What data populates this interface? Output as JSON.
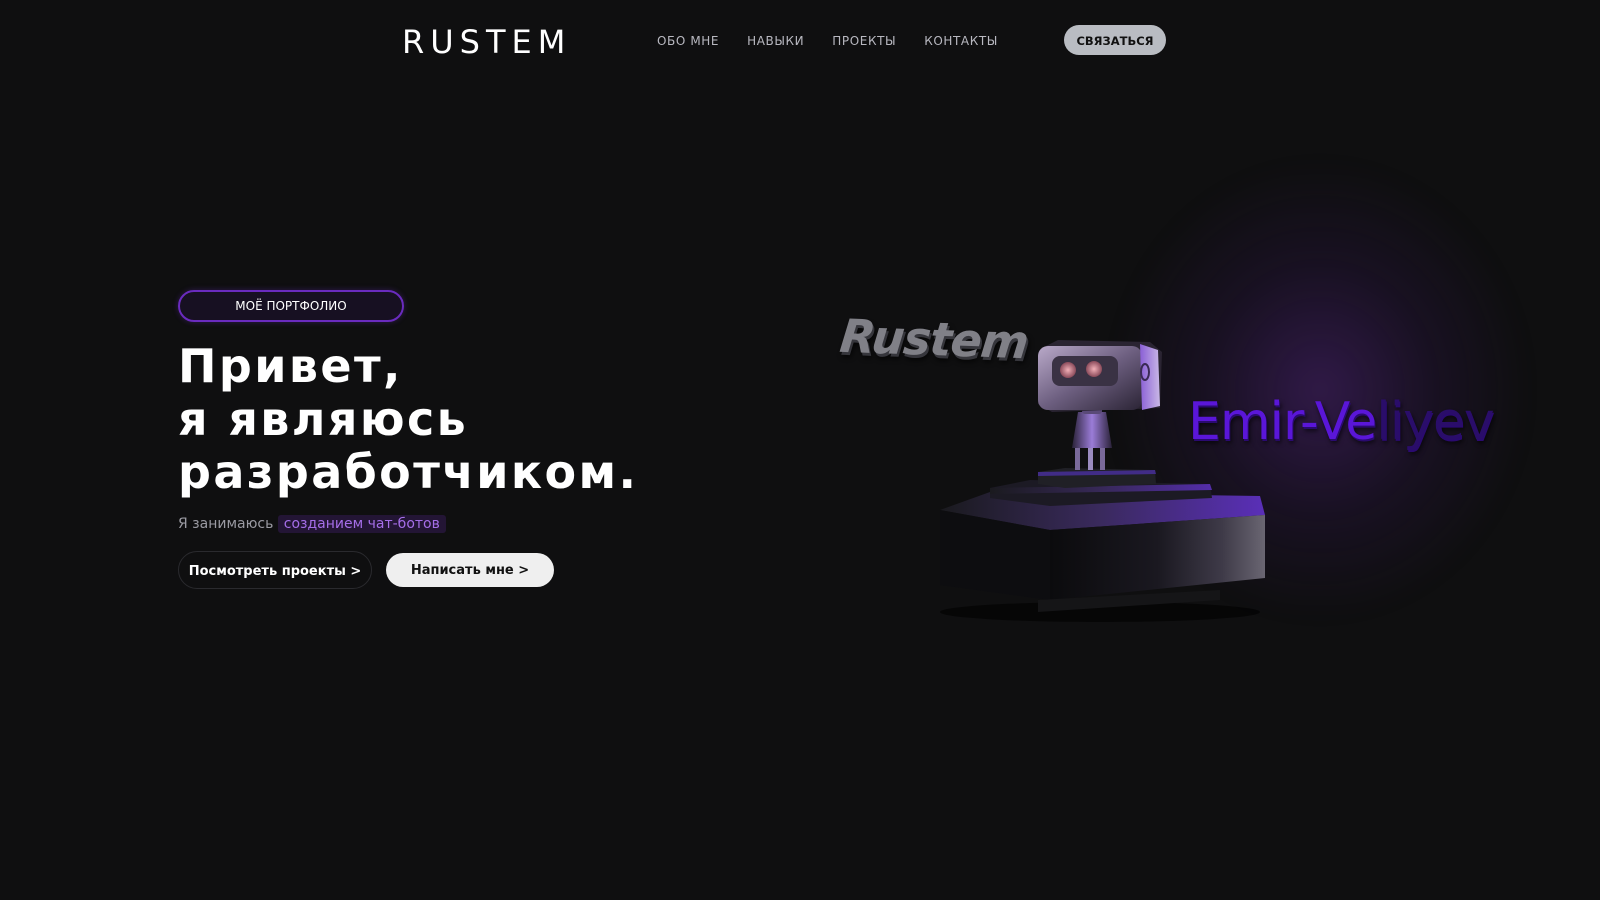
{
  "header": {
    "logo": "RUSTEM",
    "nav": [
      {
        "label": "ОБО МНЕ"
      },
      {
        "label": "НАВЫКИ"
      },
      {
        "label": "ПРОЕКТЫ"
      },
      {
        "label": "КОНТАКТЫ"
      }
    ],
    "cta_label": "СВЯЗАТЬСЯ"
  },
  "hero": {
    "badge": "МОЁ ПОРТФОЛИО",
    "headline_lines": [
      "Привет,",
      "я являюсь",
      "разработчиком."
    ],
    "subline_prefix": "Я занимаюсь",
    "subline_highlight": "созданием чат-ботов",
    "btn_projects": "Посмотреть проекты >",
    "btn_write": "Написать мне >"
  },
  "scene": {
    "word_left": "Rustem",
    "word_right_main": "Emir-Ve",
    "word_right_fade": "liyev"
  },
  "colors": {
    "background": "#0f0f10",
    "accent": "#6a2bbf",
    "highlight": "#a56ee8",
    "cta_bg": "#b9bcc2"
  }
}
